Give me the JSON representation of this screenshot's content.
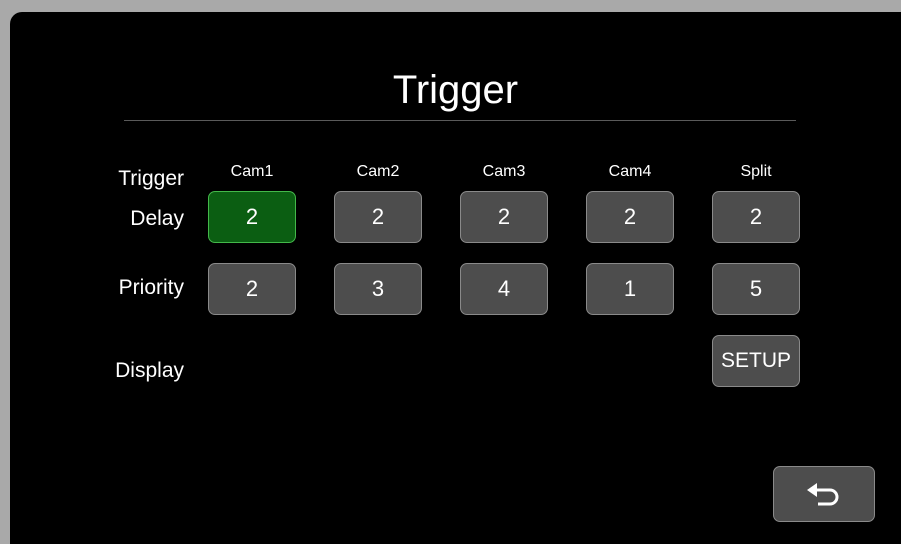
{
  "title": "Trigger",
  "row_labels": {
    "trigger": "Trigger",
    "delay": "Delay",
    "priority": "Priority",
    "display": "Display"
  },
  "columns": [
    "Cam1",
    "Cam2",
    "Cam3",
    "Cam4",
    "Split"
  ],
  "delay_values": [
    "2",
    "2",
    "2",
    "2",
    "2"
  ],
  "priority_values": [
    "2",
    "3",
    "4",
    "1",
    "5"
  ],
  "selected": {
    "row": "delay",
    "column": "Cam1"
  },
  "display_setup_label": "SETUP",
  "icons": {
    "back": "back-arrow-icon"
  },
  "colors": {
    "background": "#000000",
    "button": "#4d4d4d",
    "button_border": "#8a8a8a",
    "selected_button": "#0b5e12",
    "selected_border": "#43b84a",
    "text": "#ffffff"
  }
}
